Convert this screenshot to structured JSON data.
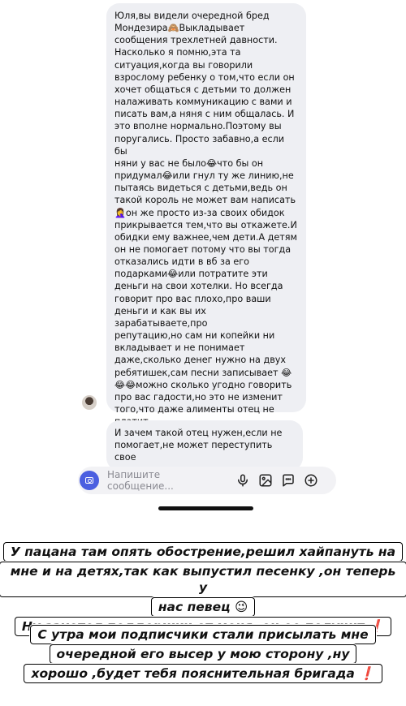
{
  "chat": {
    "message_1": "Юля,вы видели очередной бред\nМондезира🙈Выкладывает\nсообщения трехлетней давности.\nНасколько я помню,эта та\nситуация,когда вы говорили\nвзрослому ребенку о том,что если он\nхочет общаться с детьми то должен\nналаживать коммуникацию с вами и\nписать вам,а няня с ним общалась. И\nэто вполне нормально.Поэтому вы\nпоругались. Просто забавно,а если бы\nняни у вас не было😂что бы он\nпридумал😂или гнул ту же линию,не\nпытаясь видеться с детьми,ведь он\nтакой король не может вам написать\n🤦‍♀️он же просто из-за своих обидок\nприкрывается тем,что вы откажете.И\nобидки ему важнее,чем дети.А детям\nон не помогает потому что вы тогда\nотказались идти в вб за его\nподарками😂или потратите эти\nденьги на свои хотелки. Но всегда\nговорит про вас плохо,про ваши\nденьги и как вы их зарабатываете,про\nрепутацию,но сам ни копейки ни\nвкладывает и не понимает\nдаже,сколько денег нужно на двух\nребятишек,сам песни записывает 😂\n😂😂можно сколько угодно говорить\nпро вас гадости,но это не изменит\nтого,что даже алименты отец не\nплатит",
    "message_2": "И зачем такой отец нужен,если не\nпомогает,не может переступить свое\nэго и написать вам,алименты это что"
  },
  "input": {
    "placeholder": "Напишите сообщение..."
  },
  "icons": {
    "camera": "camera-icon",
    "microphone": "microphone-icon",
    "gallery": "image-icon",
    "sticker": "sticker-icon",
    "add": "plus-circle-icon"
  },
  "captions": {
    "block_1": [
      "У пацана там опять обострение,решил хайпануть на",
      "мне и на детях,так как выпустил песенку ,он теперь у",
      "нас певец 😉",
      "Ну захотел поддержки от меня ,он ее получит ❗"
    ],
    "block_2": [
      "С утра мои подписчики стали присылать мне",
      "очередной его высер у мою сторону ,ну",
      "хорошо ,будет тебя пояснительная бригада ❗"
    ]
  },
  "colors": {
    "accent": "#4b5fe0",
    "bubble": "#eeeff3",
    "caption_bg": "#ffffff"
  }
}
